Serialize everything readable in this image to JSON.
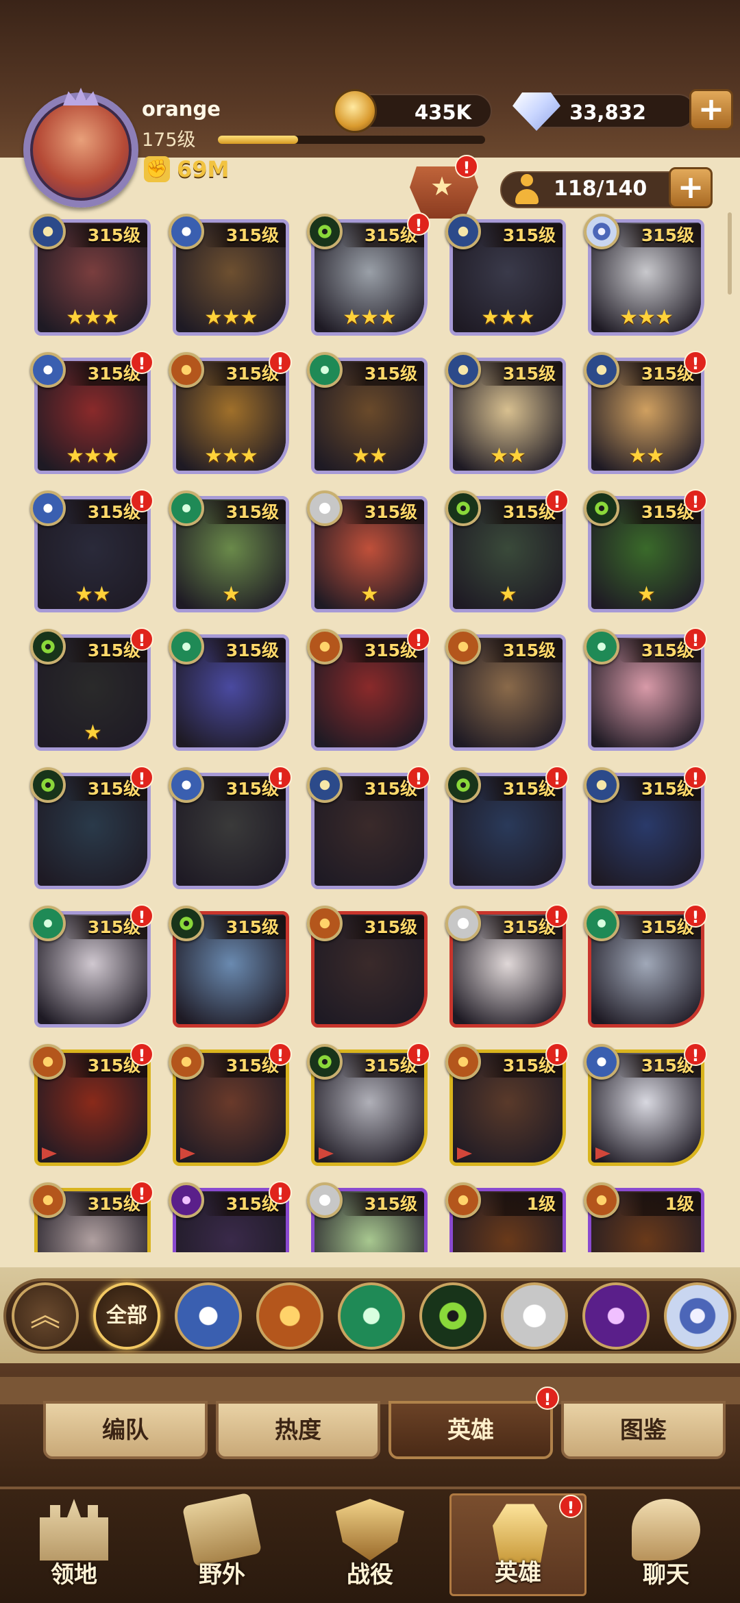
{
  "player": {
    "name": "orange",
    "level": "175级",
    "exp_fraction": 0.3,
    "power": "69M",
    "gold": "435K",
    "gems": "33,832",
    "hero_capacity": "118/140"
  },
  "colors": {
    "accent_gold": "#ffd86a",
    "alert_red": "#e0241c",
    "frame_purple": "#a79ad6",
    "frame_red": "#c8352c",
    "frame_gold": "#d9b41e",
    "frame_violet": "#8a4ad0"
  },
  "alert_mark": "!",
  "heroes": [
    {
      "level": "315级",
      "stars": "★★★",
      "faction": "light",
      "frame": "purple",
      "alert": false,
      "portrait": "#7a3e3e"
    },
    {
      "level": "315级",
      "stars": "★★★",
      "faction": "lightbearer",
      "frame": "purple",
      "alert": false,
      "portrait": "#6e5030"
    },
    {
      "level": "315级",
      "stars": "★★★",
      "faction": "grave",
      "frame": "purple",
      "alert": true,
      "portrait": "#9aa0a8"
    },
    {
      "level": "315级",
      "stars": "★★★",
      "faction": "light",
      "frame": "purple",
      "alert": false,
      "portrait": "#3a3a4a"
    },
    {
      "level": "315级",
      "stars": "★★★",
      "faction": "dim",
      "frame": "purple",
      "alert": false,
      "portrait": "#c8c8cc"
    },
    {
      "level": "315级",
      "stars": "★★★",
      "faction": "lightbearer",
      "frame": "purple",
      "alert": true,
      "portrait": "#8a2a2a"
    },
    {
      "level": "315级",
      "stars": "★★★",
      "faction": "maul",
      "frame": "purple",
      "alert": true,
      "portrait": "#a0702a"
    },
    {
      "level": "315级",
      "stars": "★★",
      "faction": "wild",
      "frame": "purple",
      "alert": false,
      "portrait": "#6a4a2a"
    },
    {
      "level": "315级",
      "stars": "★★",
      "faction": "light",
      "frame": "purple",
      "alert": false,
      "portrait": "#d8c090"
    },
    {
      "level": "315级",
      "stars": "★★",
      "faction": "light",
      "frame": "purple",
      "alert": true,
      "portrait": "#d0a060"
    },
    {
      "level": "315级",
      "stars": "★★",
      "faction": "lightbearer",
      "frame": "purple",
      "alert": true,
      "portrait": "#2a2a3a"
    },
    {
      "level": "315级",
      "stars": "★",
      "faction": "wild",
      "frame": "purple",
      "alert": false,
      "portrait": "#6a8a4a"
    },
    {
      "level": "315级",
      "stars": "★",
      "faction": "celest",
      "frame": "purple",
      "alert": false,
      "portrait": "#c0503a"
    },
    {
      "level": "315级",
      "stars": "★",
      "faction": "grave",
      "frame": "purple",
      "alert": true,
      "portrait": "#3a4a3a"
    },
    {
      "level": "315级",
      "stars": "★",
      "faction": "grave",
      "frame": "purple",
      "alert": true,
      "portrait": "#3a6a2a"
    },
    {
      "level": "315级",
      "stars": "★",
      "faction": "grave",
      "frame": "purple",
      "alert": true,
      "portrait": "#2a2a2a"
    },
    {
      "level": "315级",
      "stars": "",
      "faction": "wild",
      "frame": "purple",
      "alert": false,
      "portrait": "#4a4aa0"
    },
    {
      "level": "315级",
      "stars": "",
      "faction": "maul",
      "frame": "purple",
      "alert": true,
      "portrait": "#8a2a2a"
    },
    {
      "level": "315级",
      "stars": "",
      "faction": "maul",
      "frame": "purple",
      "alert": false,
      "portrait": "#8a6a4a"
    },
    {
      "level": "315级",
      "stars": "",
      "faction": "wild",
      "frame": "purple",
      "alert": true,
      "portrait": "#d89aa8"
    },
    {
      "level": "315级",
      "stars": "",
      "faction": "grave",
      "frame": "purple",
      "alert": true,
      "portrait": "#2a3a4a"
    },
    {
      "level": "315级",
      "stars": "",
      "faction": "lightbearer",
      "frame": "purple",
      "alert": true,
      "portrait": "#3a3a3a"
    },
    {
      "level": "315级",
      "stars": "",
      "faction": "light",
      "frame": "purple",
      "alert": true,
      "portrait": "#3a2a2a"
    },
    {
      "level": "315级",
      "stars": "",
      "faction": "grave",
      "frame": "purple",
      "alert": true,
      "portrait": "#2a3a5a"
    },
    {
      "level": "315级",
      "stars": "",
      "faction": "light",
      "frame": "purple",
      "alert": true,
      "portrait": "#2a3a6a"
    },
    {
      "level": "315级",
      "stars": "",
      "faction": "wild",
      "frame": "purple",
      "alert": true,
      "portrait": "#d0c8d0"
    },
    {
      "level": "315级",
      "stars": "",
      "faction": "grave",
      "frame": "red",
      "alert": false,
      "portrait": "#6a8ab0"
    },
    {
      "level": "315级",
      "stars": "",
      "faction": "maul",
      "frame": "red",
      "alert": false,
      "portrait": "#3a2a2a"
    },
    {
      "level": "315级",
      "stars": "",
      "faction": "celest",
      "frame": "red",
      "alert": true,
      "portrait": "#e0d8d8"
    },
    {
      "level": "315级",
      "stars": "",
      "faction": "wild",
      "frame": "red",
      "alert": true,
      "portrait": "#a0a8b8"
    },
    {
      "level": "315级",
      "stars": "",
      "faction": "maul",
      "frame": "gold",
      "alert": true,
      "portrait": "#8a2a1a"
    },
    {
      "level": "315级",
      "stars": "",
      "faction": "maul",
      "frame": "gold",
      "alert": true,
      "portrait": "#6a3a2a"
    },
    {
      "level": "315级",
      "stars": "",
      "faction": "grave",
      "frame": "gold",
      "alert": true,
      "portrait": "#b0b0b8"
    },
    {
      "level": "315级",
      "stars": "",
      "faction": "maul",
      "frame": "gold",
      "alert": true,
      "portrait": "#5a3a2a"
    },
    {
      "level": "315级",
      "stars": "",
      "faction": "lightbearer",
      "frame": "gold",
      "alert": true,
      "portrait": "#d8d8e0"
    },
    {
      "level": "315级",
      "stars": "",
      "faction": "maul",
      "frame": "gold",
      "alert": true,
      "portrait": "#b0a0a0"
    },
    {
      "level": "315级",
      "stars": "",
      "faction": "hypo",
      "frame": "violet",
      "alert": true,
      "portrait": "#3a2a4a"
    },
    {
      "level": "315级",
      "stars": "",
      "faction": "celest",
      "frame": "violet",
      "alert": false,
      "portrait": "#a8c890"
    },
    {
      "level": "1级",
      "stars": "",
      "faction": "maul",
      "frame": "violet",
      "alert": false,
      "portrait": "#6a3a1a"
    },
    {
      "level": "1级",
      "stars": "",
      "faction": "maul",
      "frame": "violet",
      "alert": false,
      "portrait": "#6a3a1a"
    }
  ],
  "filters": {
    "all_label": "全部",
    "factions": [
      "lightbearer",
      "maul",
      "wild",
      "grave",
      "celest",
      "hypo",
      "dim"
    ]
  },
  "subtabs": [
    {
      "label": "编队",
      "active": false
    },
    {
      "label": "热度",
      "active": false
    },
    {
      "label": "英雄",
      "active": true,
      "alert": true
    },
    {
      "label": "图鉴",
      "active": false
    }
  ],
  "nav": [
    {
      "label": "领地",
      "icon": "castle-icon",
      "active": false
    },
    {
      "label": "野外",
      "icon": "scroll-map-icon",
      "active": false
    },
    {
      "label": "战役",
      "icon": "sword-shield-icon",
      "active": false
    },
    {
      "label": "英雄",
      "icon": "helmet-icon",
      "active": true,
      "alert": true
    },
    {
      "label": "聊天",
      "icon": "chat-icon",
      "active": false
    }
  ]
}
